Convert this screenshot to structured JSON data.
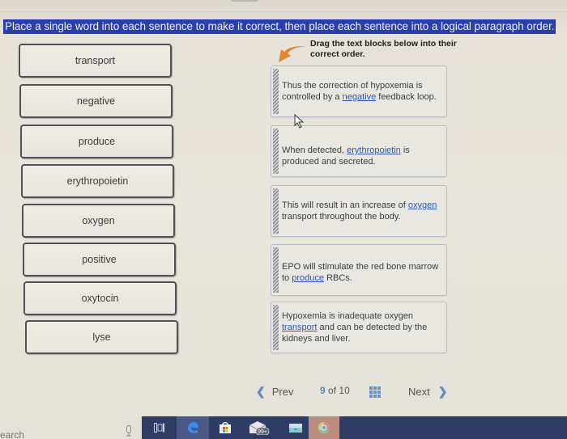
{
  "instruction": "Place a single word into each sentence to make it correct, then place each sentence into a logical paragraph order.",
  "drag_hint": "Drag the text blocks below into their correct order.",
  "word_bank": [
    "transport",
    "negative",
    "produce",
    "erythropoietin",
    "oxygen",
    "positive",
    "oxytocin",
    "lyse"
  ],
  "sentences": [
    {
      "before": "Thus the correction of hypoxemia is controlled by a ",
      "blank": "negative",
      "after": " feedback loop."
    },
    {
      "before": "When detected, ",
      "blank": "erythropoietin",
      "after": " is produced and secreted."
    },
    {
      "before": "This will result in an increase of ",
      "blank": "oxygen",
      "after": " transport throughout the body."
    },
    {
      "before": "EPO will stimulate the red bone marrow to ",
      "blank": "produce",
      "after": " RBCs."
    },
    {
      "before": "Hypoxemia is inadequate oxygen ",
      "blank": "transport",
      "after": " and can be detected by the kidneys and liver."
    }
  ],
  "navigation": {
    "prev_label": "Prev",
    "next_label": "Next",
    "current_page": "9",
    "of_label": "of",
    "total_pages": "10"
  },
  "taskbar": {
    "search_text": "earch",
    "mail_badge": "99+",
    "icons": [
      "mic-icon",
      "task-view-icon",
      "edge-icon",
      "store-icon",
      "mail-icon",
      "file-explorer-icon",
      "chrome-icon"
    ]
  },
  "colors": {
    "instruction_bg": "#2a3fae",
    "link_blue": "#2a56c6",
    "arrow_orange": "#e0862e",
    "taskbar_bg": "#2e3c66"
  }
}
